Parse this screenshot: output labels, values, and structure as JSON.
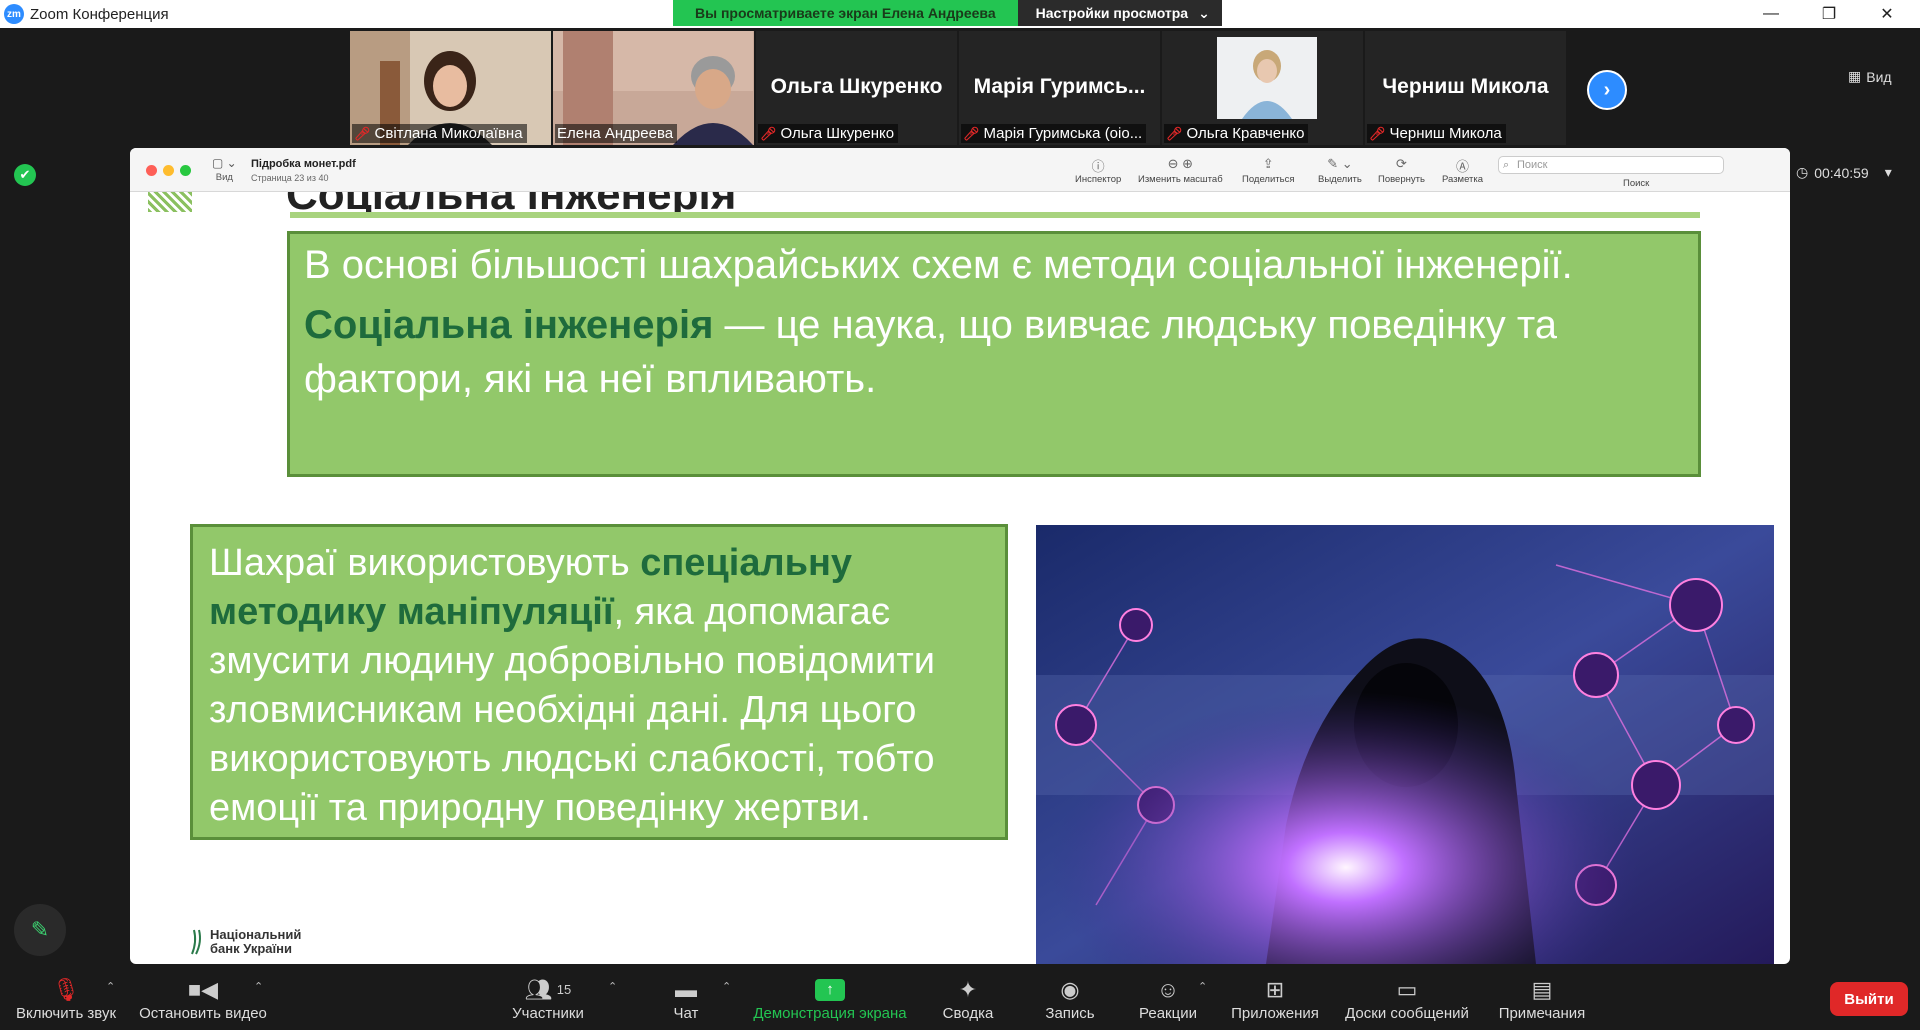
{
  "window": {
    "app_title": "Zoom Конференция",
    "logo_text": "zm",
    "viewing_banner": "Вы просматриваете экран Елена Андреева",
    "view_settings_label": "Настройки просмотра"
  },
  "participants": [
    {
      "name": "Світлана Миколаївна",
      "video": true
    },
    {
      "name": "Елена Андреева",
      "video": true,
      "active": true
    },
    {
      "name": "Ольга Шкуренко",
      "video": false,
      "display": "Ольга Шкуренко"
    },
    {
      "name": "Марія Гуримська (оіо...",
      "video": false,
      "display": "Марія Гуримсь..."
    },
    {
      "name": "Ольга Кравченко",
      "video": true
    },
    {
      "name": "Черниш Микола",
      "video": false,
      "display": "Черниш Микола"
    }
  ],
  "view_label": "Вид",
  "timer": "00:40:59",
  "pdf": {
    "filename": "Підробка монет.pdf",
    "page_info": "Страница 23 из 40",
    "sidebar_label": "Вид",
    "tools": [
      "Инспектор",
      "Изменить масштаб",
      "Поделиться",
      "Выделить",
      "Повернуть",
      "Разметка"
    ],
    "search_placeholder": "Поиск",
    "search_label": "Поиск"
  },
  "slide": {
    "title": "Соціальна інженерія",
    "top_line1": "В основі більшості шахрайських схем є методи соціальної інженерії.",
    "top_term": "Соціальна інженерія",
    "top_line2": " — це наука, що вивчає людську поведінку та фактори, які на неї впливають.",
    "left_part1": "Шахраї використовують ",
    "left_bold": "спеціальну методику маніпуляції",
    "left_part2": ", яка допомагає змусити людину добровільно повідомити зловмисникам необхідні дані. Для цього використовують людські слабкості, тобто емоції та природну поведінку жертви.",
    "logo_line1": "Національний",
    "logo_line2": "банк України"
  },
  "toolbar": {
    "audio": "Включить звук",
    "video": "Остановить видео",
    "participants": "Участники",
    "participants_count": "15",
    "chat": "Чат",
    "share": "Демонстрация экрана",
    "summary": "Сводка",
    "record": "Запись",
    "reactions": "Реакции",
    "apps": "Приложения",
    "whiteboards": "Доски сообщений",
    "notes": "Примечания",
    "leave": "Выйти"
  },
  "colors": {
    "banner_green": "#23c552",
    "slide_box_green": "#92c86a",
    "slide_dark_green": "#1e6b3c",
    "zoom_blue": "#2d8cff",
    "leave_red": "#e02828"
  }
}
